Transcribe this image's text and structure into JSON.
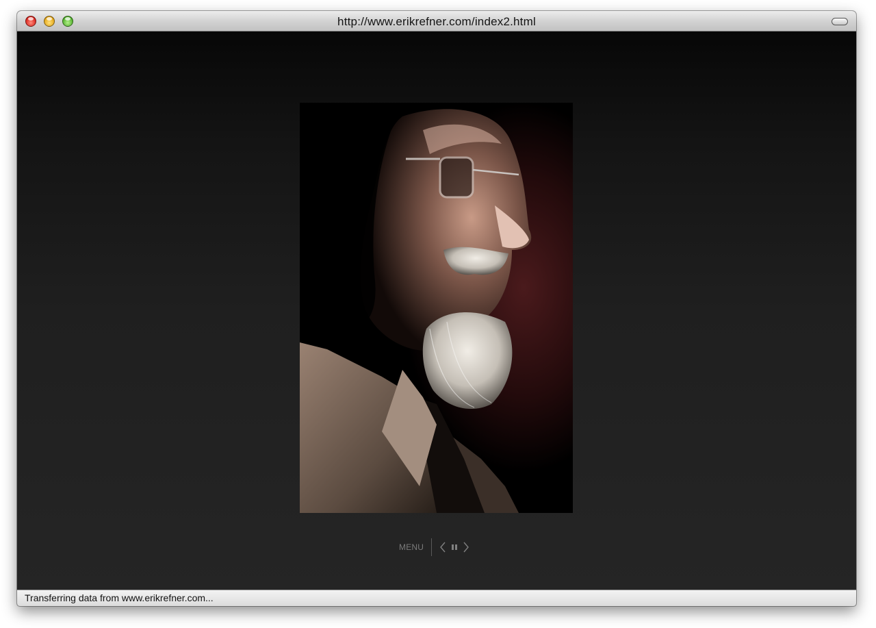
{
  "window": {
    "title": "http://www.erikrefner.com/index2.html"
  },
  "icons": {
    "close": "close-icon",
    "minimize": "minimize-icon",
    "zoom": "zoom-icon",
    "toolbar_toggle": "toolbar-toggle-icon",
    "prev": "chevron-left-icon",
    "pause": "pause-icon",
    "next": "chevron-right-icon"
  },
  "gallery": {
    "menu_label": "MENU"
  },
  "status": {
    "text": "Transferring data from www.erikrefner.com..."
  },
  "colors": {
    "background": "#232323",
    "control_text": "#7b7b7b"
  }
}
